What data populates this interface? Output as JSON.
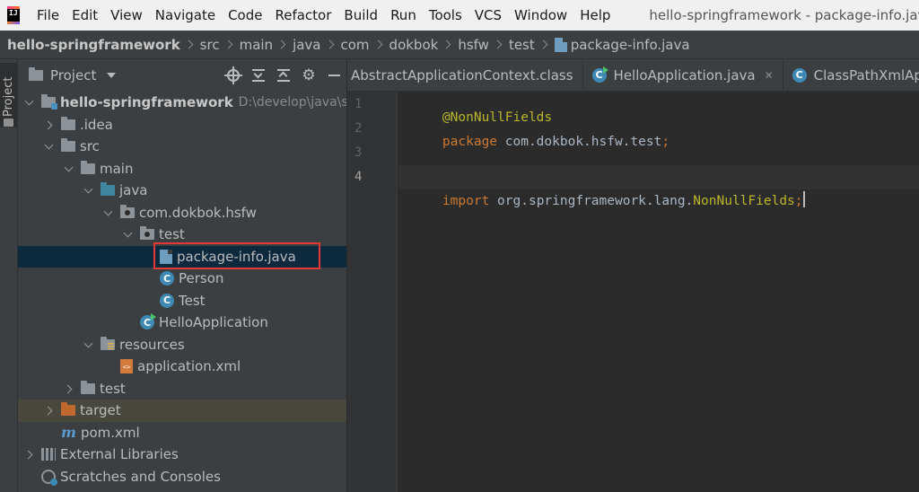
{
  "menu": {
    "items": [
      "File",
      "Edit",
      "View",
      "Navigate",
      "Code",
      "Refactor",
      "Build",
      "Run",
      "Tools",
      "VCS",
      "Window",
      "Help"
    ],
    "window_title": "hello-springframework - package-info.java"
  },
  "breadcrumb": [
    "hello-springframework",
    "src",
    "main",
    "java",
    "com",
    "dokbok",
    "hsfw",
    "test",
    "package-info.java"
  ],
  "toolstrip": {
    "label": "Project"
  },
  "project_panel": {
    "title": "Project",
    "tree": [
      {
        "label": "hello-springframework",
        "path": "D:\\develop\\java\\stu",
        "icon": "module-folder-icon"
      },
      {
        "label": ".idea",
        "icon": "folder-icon"
      },
      {
        "label": "src",
        "icon": "folder-icon"
      },
      {
        "label": "main",
        "icon": "folder-icon"
      },
      {
        "label": "java",
        "icon": "source-folder-icon"
      },
      {
        "label": "com.dokbok.hsfw",
        "icon": "package-icon"
      },
      {
        "label": "test",
        "icon": "package-icon"
      },
      {
        "label": "package-info.java",
        "icon": "package-info-file-icon"
      },
      {
        "label": "Person",
        "icon": "class-icon"
      },
      {
        "label": "Test",
        "icon": "class-icon"
      },
      {
        "label": "HelloApplication",
        "icon": "runnable-class-icon"
      },
      {
        "label": "resources",
        "icon": "resources-folder-icon"
      },
      {
        "label": "application.xml",
        "icon": "xml-file-icon"
      },
      {
        "label": "test",
        "icon": "folder-icon"
      },
      {
        "label": "target",
        "icon": "excluded-folder-icon"
      },
      {
        "label": "pom.xml",
        "icon": "maven-icon"
      },
      {
        "label": "External Libraries",
        "icon": "libraries-icon"
      },
      {
        "label": "Scratches and Consoles",
        "icon": "scratches-icon"
      }
    ]
  },
  "editor": {
    "tabs": [
      {
        "label": "AbstractApplicationContext.class"
      },
      {
        "label": "HelloApplication.java"
      },
      {
        "label": "ClassPathXmlApp"
      }
    ],
    "line_numbers": [
      "1",
      "2",
      "3",
      "4"
    ],
    "code": {
      "line1": {
        "annotation": "@NonNullFields"
      },
      "line2": {
        "keyword": "package",
        "name": " com.dokbok.hsfw.test",
        "semi": ";"
      },
      "line4": {
        "keyword": "import",
        "name": " org.springframework.lang.",
        "cls": "NonNullFields",
        "semi": ";"
      }
    }
  },
  "colors": {
    "highlight_box": "#e53935",
    "selection": "#0d293e",
    "keyword": "#cc7832",
    "annotation": "#bbb529"
  }
}
